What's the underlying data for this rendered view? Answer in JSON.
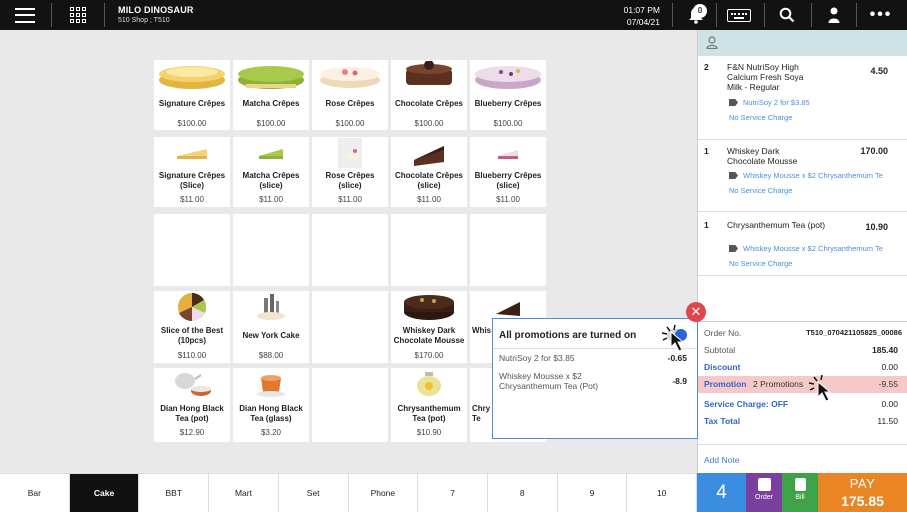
{
  "topbar": {
    "shop_name": "MILO DINOSAUR",
    "shop_sub": "510 Shop ; T510",
    "time": "01:07 PM",
    "date": "07/04/21",
    "notification_count": "0",
    "icons": [
      "hamburger-menu-icon",
      "grid-icon",
      "bell-icon",
      "keyboard-icon",
      "search-icon",
      "user-icon",
      "more-icon"
    ]
  },
  "products": [
    {
      "name": "Signature Crêpes",
      "price": "$100.00",
      "image": "crepe-cake"
    },
    {
      "name": "Matcha Crêpes",
      "price": "$100.00",
      "image": "matcha-cake"
    },
    {
      "name": "Rose Crêpes",
      "price": "$100.00",
      "image": "rose-cake"
    },
    {
      "name": "Chocolate Crêpes",
      "price": "$100.00",
      "image": "chocolate-cake"
    },
    {
      "name": "Blueberry Crêpes",
      "price": "$100.00",
      "image": "blueberry-cake"
    },
    {
      "name": "Signature Crêpes (Slice)",
      "price": "$11.00",
      "image": "crepe-slice"
    },
    {
      "name": "Matcha Crêpes (slice)",
      "price": "$11.00",
      "image": "matcha-slice"
    },
    {
      "name": "Rose Crêpes (slice)",
      "price": "$11.00",
      "image": "rose-slice"
    },
    {
      "name": "Chocolate Crêpes (slice)",
      "price": "$11.00",
      "image": "chocolate-slice"
    },
    {
      "name": "Blueberry Crêpes (slice)",
      "price": "$11.00",
      "image": "blueberry-slice"
    },
    {
      "name": "Slice of the Best (10pcs)",
      "price": "$110.00",
      "image": "best-slices"
    },
    {
      "name": "New York Cake",
      "price": "$88.00",
      "image": "new-york-cake"
    },
    {
      "name": "Whiskey Dark Chocolate Mousse",
      "price": "$170.00",
      "image": "whiskey-mousse"
    },
    {
      "name": "Whis",
      "price": "",
      "image": "whiskey-slice"
    },
    {
      "name": "Dian Hong Black Tea (pot)",
      "price": "$12.90",
      "image": "tea-pot"
    },
    {
      "name": "Dian Hong Black Tea (glass)",
      "price": "$3.20",
      "image": "tea-glass"
    },
    {
      "name": "Chrysanthemum Tea (pot)",
      "price": "$10.90",
      "image": "chrysanthemum-pot"
    },
    {
      "name": "Chry Te",
      "price": "",
      "image": "chrysanthemum-glass"
    }
  ],
  "categories": [
    "Bar",
    "Cake",
    "BBT",
    "Mart",
    "Set",
    "Phone",
    "7",
    "8",
    "9",
    "10"
  ],
  "active_category": "Cake",
  "order": {
    "items": [
      {
        "qty": "2",
        "name": "F&N NutriSoy High Calcium Fresh Soya Milk - Regular",
        "price": "4.50",
        "promo": "NutriSoy 2 for $3.85",
        "service": "No Service Charge"
      },
      {
        "qty": "1",
        "name": "Whiskey Dark Chocolate Mousse",
        "price": "170.00",
        "promo": "Whiskey Mousse x $2 Chrysanthemum Te",
        "service": "No Service Charge"
      },
      {
        "qty": "1",
        "name": "Chrysanthemum Tea (pot)",
        "price": "10.90",
        "promo": "Whiskey Mousse x $2 Chrysanthemum Te",
        "service": "No Service Charge"
      }
    ],
    "order_no_label": "Order No.",
    "order_no": "T510_070421105825_00086",
    "subtotal_label": "Subtotal",
    "subtotal": "185.40",
    "discount_label": "Discount",
    "discount": "0.00",
    "promotion_label": "Promotion",
    "promotion_count": "2 Promotions",
    "promotion": "-9.55",
    "service_label": "Service Charge: OFF",
    "service": "0.00",
    "tax_label": "Tax Total",
    "tax": "11.50",
    "add_note": "Add Note"
  },
  "actions": {
    "count": "4",
    "order_label": "Order",
    "bill_label": "Bill",
    "pay_label": "PAY",
    "pay_amount": "175.85"
  },
  "popup": {
    "title": "All promotions are turned on",
    "promotions": [
      {
        "name": "NutriSoy 2 for $3.85",
        "value": "-0.65"
      },
      {
        "name": "Whiskey Mousse x $2 Chrysanthemum Tea (Pot)",
        "value": "-8.9"
      }
    ]
  },
  "colors": {
    "topbar": "#121212",
    "grid_background": "#e9e9e9",
    "panel_header": "#cde3e6",
    "promotion_highlight": "#f6c9c9",
    "count_button": "#3b8de0",
    "order_button": "#7b3fa0",
    "bill_button": "#3da346",
    "pay_button": "#e98523",
    "link_blue": "#4a90d9",
    "close_red": "#e0464b"
  }
}
